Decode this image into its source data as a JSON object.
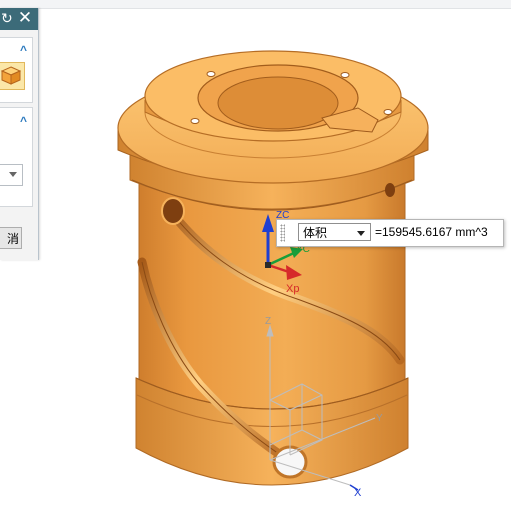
{
  "dialog": {
    "reset_glyph": "↻",
    "close_glyph": "✕",
    "collapse_glyph": "^",
    "cancel_label": "消"
  },
  "measurement": {
    "type_option": "体积",
    "value_text": "=159545.6167 mm^3"
  },
  "triad": {
    "zc_label": "ZC",
    "yc_label": "YC",
    "xc_label": "Xp",
    "z_label": "Z",
    "y_label": "Y",
    "x_label": "X"
  },
  "colors": {
    "part": "#f2a84a",
    "part_dark": "#c8772a",
    "titlebar": "#3c6b79",
    "axis_z": "#1f3fd1",
    "axis_y": "#1a9e3a",
    "axis_x": "#d62a2a"
  },
  "icons": [
    "reset-icon",
    "close-icon",
    "solid-body-icon",
    "collapse-icon",
    "dropdown-arrow-icon"
  ]
}
